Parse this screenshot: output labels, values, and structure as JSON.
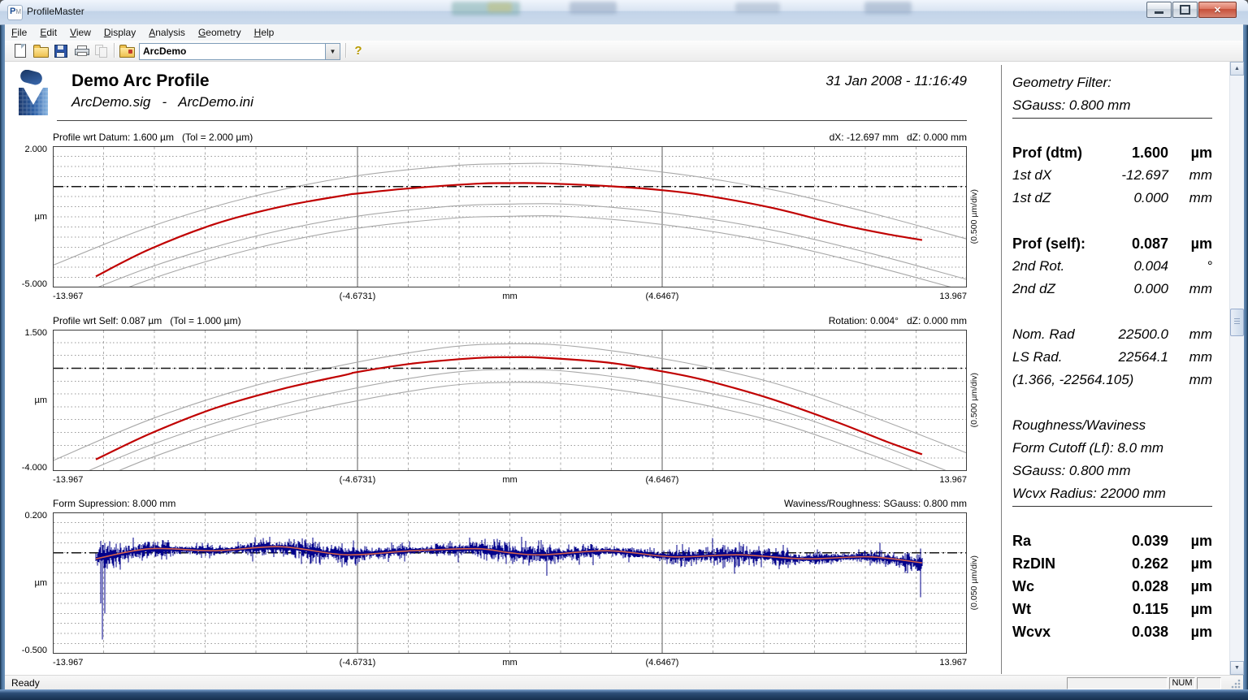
{
  "window": {
    "title": "ProfileMaster"
  },
  "menu": {
    "items": [
      "File",
      "Edit",
      "View",
      "Display",
      "Analysis",
      "Geometry",
      "Help"
    ]
  },
  "toolbar": {
    "icons": [
      "new",
      "open",
      "save",
      "print",
      "copy",
      "config-folder",
      "help"
    ],
    "document_combo": {
      "value": "ArcDemo"
    }
  },
  "doc_header": {
    "title": "Demo Arc Profile",
    "subtitle": "ArcDemo.sig   -   ArcDemo.ini",
    "datetime": "31 Jan 2008 - 11:16:49"
  },
  "chart_data": [
    {
      "type": "line",
      "title_left": "Profile wrt Datum: 1.600 µm   (Tol = 2.000 µm)",
      "title_right": "dX: -12.697 mm   dZ: 0.000 mm",
      "ylabel_top": "2.000",
      "ylabel_mid": "µm",
      "ylabel_bottom": "-5.000",
      "ydiv_label": "(0.500 µm/div)",
      "xticks": [
        "-13.967",
        "(-4.6731)",
        "mm",
        "(4.6467)",
        "13.967"
      ],
      "xlim": [
        -13.967,
        13.967
      ],
      "ylim": [
        -5.0,
        2.0
      ],
      "ydiv": 0.5,
      "xdivs": 18,
      "x_markers": [
        -4.6731,
        4.6467
      ],
      "zero_line": 0,
      "grid": true,
      "series": {
        "name": "profile-wrt-datum",
        "color": "#c00000",
        "x": [
          -12.65,
          -11,
          -9,
          -7,
          -5,
          -4.67,
          -3,
          -1,
          0,
          1,
          3,
          4.65,
          6,
          8,
          10,
          11.5,
          12.6
        ],
        "y": [
          -4.45,
          -3.1,
          -1.85,
          -1.0,
          -0.42,
          -0.35,
          -0.08,
          0.14,
          0.17,
          0.16,
          0.02,
          -0.18,
          -0.45,
          -1.05,
          -1.85,
          -2.35,
          -2.65
        ]
      },
      "band": {
        "color": "#a8a8a8",
        "nominal_x": [
          -13.967,
          -11,
          -8,
          -5,
          -2,
          0,
          2,
          5,
          8,
          11,
          13.967
        ],
        "nominal_y": [
          -4.9,
          -3.0,
          -1.55,
          -0.55,
          0.0,
          0.13,
          0.1,
          -0.35,
          -1.15,
          -2.3,
          -3.6
        ],
        "offsets": [
          1.0,
          -1.0,
          -1.6
        ]
      }
    },
    {
      "type": "line",
      "title_left": "Profile wrt Self: 0.087 µm   (Tol = 1.000 µm)",
      "title_right": "Rotation: 0.004°   dZ: 0.000 mm",
      "ylabel_top": "1.500",
      "ylabel_mid": "µm",
      "ylabel_bottom": "-4.000",
      "ydiv_label": "(0.500 µm/div)",
      "xticks": [
        "-13.967",
        "(-4.6731)",
        "mm",
        "(4.6467)",
        "13.967"
      ],
      "xlim": [
        -13.967,
        13.967
      ],
      "ylim": [
        -4.0,
        1.5
      ],
      "ydiv": 0.5,
      "xdivs": 18,
      "x_markers": [
        -4.6731,
        4.6467
      ],
      "zero_line": 0,
      "grid": true,
      "series": {
        "name": "profile-wrt-self",
        "color": "#c00000",
        "x": [
          -12.65,
          -11,
          -9,
          -7,
          -5,
          -4.67,
          -3,
          -1,
          0,
          1,
          3,
          4.65,
          6,
          8,
          10,
          11.5,
          12.6
        ],
        "y": [
          -3.55,
          -2.55,
          -1.55,
          -0.82,
          -0.25,
          -0.15,
          0.18,
          0.4,
          0.43,
          0.41,
          0.22,
          -0.12,
          -0.48,
          -1.2,
          -2.1,
          -2.85,
          -3.35
        ]
      },
      "band": {
        "color": "#a8a8a8",
        "nominal_x": [
          -13.967,
          -11,
          -8,
          -5,
          -2,
          0,
          2,
          5,
          8,
          11,
          13.967
        ],
        "nominal_y": [
          -4.1,
          -2.5,
          -1.25,
          -0.35,
          0.3,
          0.45,
          0.35,
          -0.2,
          -1.05,
          -2.35,
          -3.8
        ],
        "offsets": [
          0.5,
          -0.5,
          -1.0
        ]
      }
    },
    {
      "type": "line",
      "title_left": "Form Supression: 8.000 mm",
      "title_right": "Waviness/Roughness: SGauss: 0.800 mm",
      "ylabel_top": "0.200",
      "ylabel_mid": "µm",
      "ylabel_bottom": "-0.500",
      "ydiv_label": "(0.050 µm/div)",
      "xticks": [
        "-13.967",
        "(-4.6731)",
        "mm",
        "(4.6467)",
        "13.967"
      ],
      "xlim": [
        -13.967,
        13.967
      ],
      "ylim": [
        -0.5,
        0.2
      ],
      "ydiv": 0.05,
      "xdivs": 18,
      "x_markers": [
        -4.6731,
        4.6467
      ],
      "zero_line": 0,
      "grid": true,
      "noise": {
        "name": "roughness-signal",
        "color": "#00008b",
        "seed": 7,
        "sigma_um": 0.045,
        "x_range": [
          -12.65,
          12.6
        ],
        "spikes": [
          {
            "x": -12.5,
            "lo": -0.25,
            "hi": 0.06
          },
          {
            "x": -12.45,
            "lo": -0.43,
            "hi": 0.04
          },
          {
            "x": -12.38,
            "lo": -0.3,
            "hi": 0.05
          },
          {
            "x": 12.55,
            "lo": -0.22,
            "hi": 0.02
          }
        ]
      },
      "series": {
        "name": "waviness-mean-line",
        "color": "#d4604a",
        "x": [
          -12.65,
          -11,
          -9,
          -7,
          -5,
          -3,
          -1,
          0,
          1,
          3,
          5,
          7,
          9,
          11,
          12.6
        ],
        "y": [
          -0.03,
          0.02,
          0.01,
          0.03,
          -0.01,
          0.01,
          0.02,
          0.0,
          -0.01,
          0.01,
          -0.02,
          -0.01,
          -0.03,
          -0.02,
          -0.05
        ]
      }
    }
  ],
  "side_panel": {
    "sections": [
      {
        "rule_below": true,
        "rows": [
          {
            "label": "Geometry Filter:"
          },
          {
            "label": "SGauss: 0.800 mm"
          }
        ]
      },
      {
        "rows": [
          {
            "label": "Prof (dtm)",
            "value": "1.600",
            "unit": "µm",
            "bold": true
          },
          {
            "label": "1st dX",
            "value": "-12.697",
            "unit": "mm"
          },
          {
            "label": "1st dZ",
            "value": "0.000",
            "unit": "mm"
          }
        ]
      },
      {
        "rows": [
          {
            "label": "Prof (self):",
            "value": "0.087",
            "unit": "µm",
            "bold": true
          },
          {
            "label": "2nd Rot.",
            "value": "0.004",
            "unit": "°"
          },
          {
            "label": "2nd dZ",
            "value": "0.000",
            "unit": "mm"
          }
        ]
      },
      {
        "rows": [
          {
            "label": "Nom. Rad",
            "value": "22500.0",
            "unit": "mm"
          },
          {
            "label": "LS Rad.",
            "value": "22564.1",
            "unit": "mm"
          },
          {
            "label": "(1.366, -22564.105)",
            "unit": "mm"
          }
        ]
      },
      {
        "rule_below": true,
        "rows": [
          {
            "label": "Roughness/Waviness"
          },
          {
            "label": "Form Cutoff (Lf): 8.0 mm"
          },
          {
            "label": "SGauss: 0.800 mm"
          },
          {
            "label": "Wcvx Radius: 22000 mm"
          }
        ]
      },
      {
        "rows": [
          {
            "label": "Ra",
            "value": "0.039",
            "unit": "µm",
            "bold": true
          },
          {
            "label": "RzDIN",
            "value": "0.262",
            "unit": "µm",
            "bold": true
          },
          {
            "label": "Wc",
            "value": "0.028",
            "unit": "µm",
            "bold": true
          },
          {
            "label": "Wt",
            "value": "0.115",
            "unit": "µm",
            "bold": true
          },
          {
            "label": "Wcvx",
            "value": "0.038",
            "unit": "µm",
            "bold": true
          }
        ]
      }
    ]
  },
  "status_bar": {
    "message": "Ready",
    "indicator": "NUM"
  }
}
